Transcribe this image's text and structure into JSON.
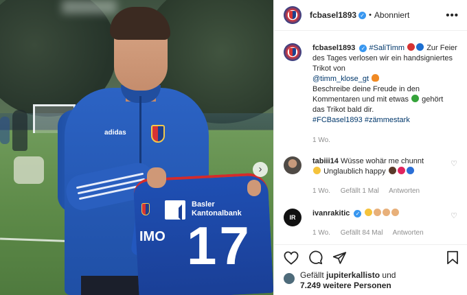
{
  "post": {
    "account": "fcbasel1893",
    "follow_state": "Abonniert",
    "dot": "•",
    "more": "•••",
    "next_arrow": "›",
    "jersey": {
      "number": "17",
      "name": "IMO",
      "sponsor_line1": "Basler",
      "sponsor_line2": "Kantonalbank",
      "brand": "adidas"
    }
  },
  "caption": {
    "user": "fcbasel1893",
    "hashtag_top": "#SaliTimm",
    "text1": "Zur Feier des Tages verlosen wir ein handsigniertes Trikot von",
    "mention": "@timm_klose_gt",
    "text2": "Beschreibe deine Freude in den Kommentaren und mit etwas",
    "text3": "gehört das Trikot bald dir.",
    "hashtags": "#FCBasel1893 #zämmestark",
    "time": "1 Wo."
  },
  "comments": [
    {
      "user": "tabiii14",
      "text": "Wüsse wohär me chunnt",
      "text2": "Unglaublich happy",
      "time": "1 Wo.",
      "likes": "Gefällt 1 Mal",
      "reply": "Antworten"
    },
    {
      "user": "ivanrakitic",
      "avatar_text": "IR",
      "time": "1 Wo.",
      "likes": "Gefällt 84 Mal",
      "reply": "Antworten"
    }
  ],
  "likes": {
    "prefix": "Gefällt",
    "user": "jupiterkallisto",
    "middle": "und",
    "count": "7.249 weitere Personen"
  },
  "icons": {
    "like": "heart-icon",
    "comment": "comment-icon",
    "share": "share-icon",
    "save": "bookmark-icon",
    "verified": "verified-icon"
  },
  "colors": {
    "link": "#00376b",
    "verified": "#3897f0",
    "muted": "#8e8e8e",
    "club_red": "#d63434",
    "club_blue": "#1c3f8f"
  }
}
